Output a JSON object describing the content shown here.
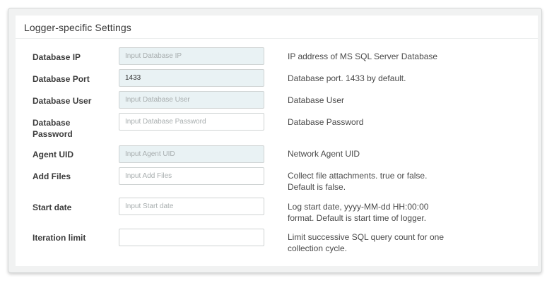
{
  "panel": {
    "title": "Logger-specific Settings"
  },
  "fields": [
    {
      "label": "Database IP",
      "value": "",
      "placeholder": "Input Database IP",
      "description": "IP address of MS SQL Server Database"
    },
    {
      "label": "Database Port",
      "value": "1433",
      "placeholder": "",
      "description": "Database port. 1433 by default."
    },
    {
      "label": "Database User",
      "value": "",
      "placeholder": "Input Database User",
      "description": "Database User"
    },
    {
      "label": "Database Password",
      "value": "",
      "placeholder": "Input Database Password",
      "description": "Database Password"
    },
    {
      "label": "Agent UID",
      "value": "",
      "placeholder": "Input Agent UID",
      "description": "Network Agent UID"
    },
    {
      "label": "Add Files",
      "value": "",
      "placeholder": "Input Add Files",
      "description": "Collect file attachments. true or false. Default is false."
    },
    {
      "label": "Start date",
      "value": "",
      "placeholder": "Input Start date",
      "description": "Log start date, yyyy-MM-dd HH:00:00 format. Default is start time of logger."
    },
    {
      "label": "Iteration limit",
      "value": "",
      "placeholder": "",
      "description": "Limit successive SQL query count for one collection cycle."
    }
  ],
  "colors": {
    "readonly_field_bg": "#e9f2f4",
    "field_border": "#cfd3d3",
    "label_text": "#3c3c3c"
  }
}
